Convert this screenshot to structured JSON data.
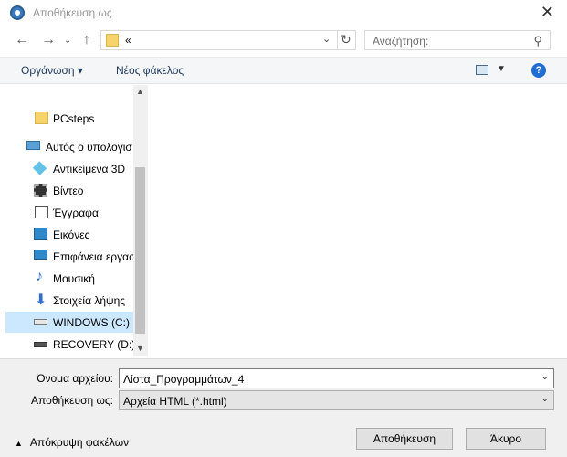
{
  "window": {
    "title": "Αποθήκευση ως"
  },
  "nav": {
    "address": "«",
    "search_placeholder": "Αναζήτηση:"
  },
  "toolbar": {
    "organize": "Οργάνωση ▾",
    "new_folder": "Νέος φάκελος",
    "help": "?"
  },
  "tree": [
    {
      "label": "PCsteps",
      "icon": "folder-icon"
    },
    {
      "label": "Αυτός ο υπολογισ",
      "icon": "computer-icon"
    },
    {
      "label": "Αντικείμενα 3D",
      "icon": "3d-objects-icon"
    },
    {
      "label": "Βίντεο",
      "icon": "video-icon"
    },
    {
      "label": "Έγγραφα",
      "icon": "documents-icon"
    },
    {
      "label": "Εικόνες",
      "icon": "pictures-icon"
    },
    {
      "label": "Επιφάνεια εργασ",
      "icon": "desktop-icon"
    },
    {
      "label": "Μουσική",
      "icon": "music-icon"
    },
    {
      "label": "Στοιχεία λήψης",
      "icon": "downloads-icon"
    },
    {
      "label": "WINDOWS (C:)",
      "icon": "drive-icon",
      "selected": true
    },
    {
      "label": "RECOVERY (D:)",
      "icon": "drive-icon"
    }
  ],
  "form": {
    "filename_label": "Όνομα αρχείου:",
    "filename_value": "Λίστα_Προγραμμάτων_4",
    "type_label": "Αποθήκευση ως:",
    "type_value": "Αρχεία HTML (*.html)"
  },
  "footer": {
    "hide_folders": "Απόκρυψη φακέλων",
    "save": "Αποθήκευση",
    "cancel": "Άκυρο"
  }
}
